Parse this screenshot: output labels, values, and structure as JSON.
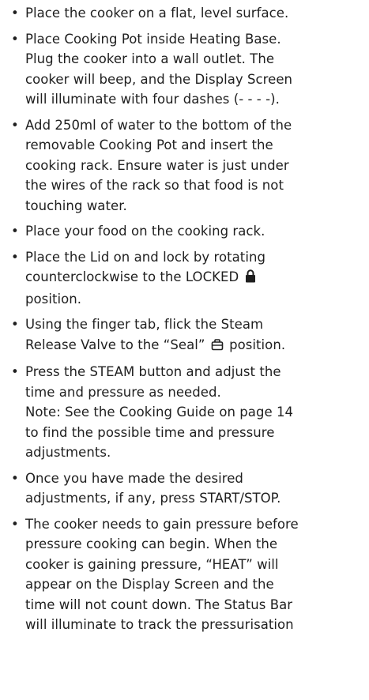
{
  "steps": [
    {
      "lines": [
        "Place the cooker on a flat, level surface."
      ]
    },
    {
      "lines": [
        "Place Cooking Pot inside Heating Base.",
        "Plug the cooker into a wall outlet. The",
        "cooker will beep, and the Display Screen",
        "will illuminate with four dashes (- - - -)."
      ]
    },
    {
      "lines": [
        "Add 250ml of water to the bottom of the",
        "removable Cooking Pot and insert the",
        "cooking rack. Ensure water is just under",
        "the wires of the rack so that food is not",
        "touching water."
      ]
    },
    {
      "lines": [
        "Place your food on the cooking rack."
      ]
    },
    {
      "line1": "Place the Lid on and lock by rotating",
      "line2a": "counterclockwise to the LOCKED",
      "line3": "position.",
      "icon": "lock-icon"
    },
    {
      "line1": "Using the finger tab, flick the Steam",
      "line2a": "Release Valve to the “Seal”",
      "line2b": "position.",
      "icon": "seal-valve-icon"
    },
    {
      "lines": [
        "Press the STEAM button and adjust the",
        "time and pressure as needed.",
        "Note: See the Cooking Guide on page 14",
        "to find the possible time and pressure",
        "adjustments."
      ]
    },
    {
      "lines": [
        "Once you have made the desired",
        "adjustments, if any, press START/STOP."
      ]
    },
    {
      "lines": [
        "The cooker needs to gain pressure before",
        "pressure cooking can begin. When the",
        "cooker is gaining pressure, “HEAT” will",
        "appear on the Display Screen and the",
        "time will not count down. The Status Bar",
        "will illuminate to track the pressurisation"
      ]
    }
  ],
  "bullet_char": "•"
}
